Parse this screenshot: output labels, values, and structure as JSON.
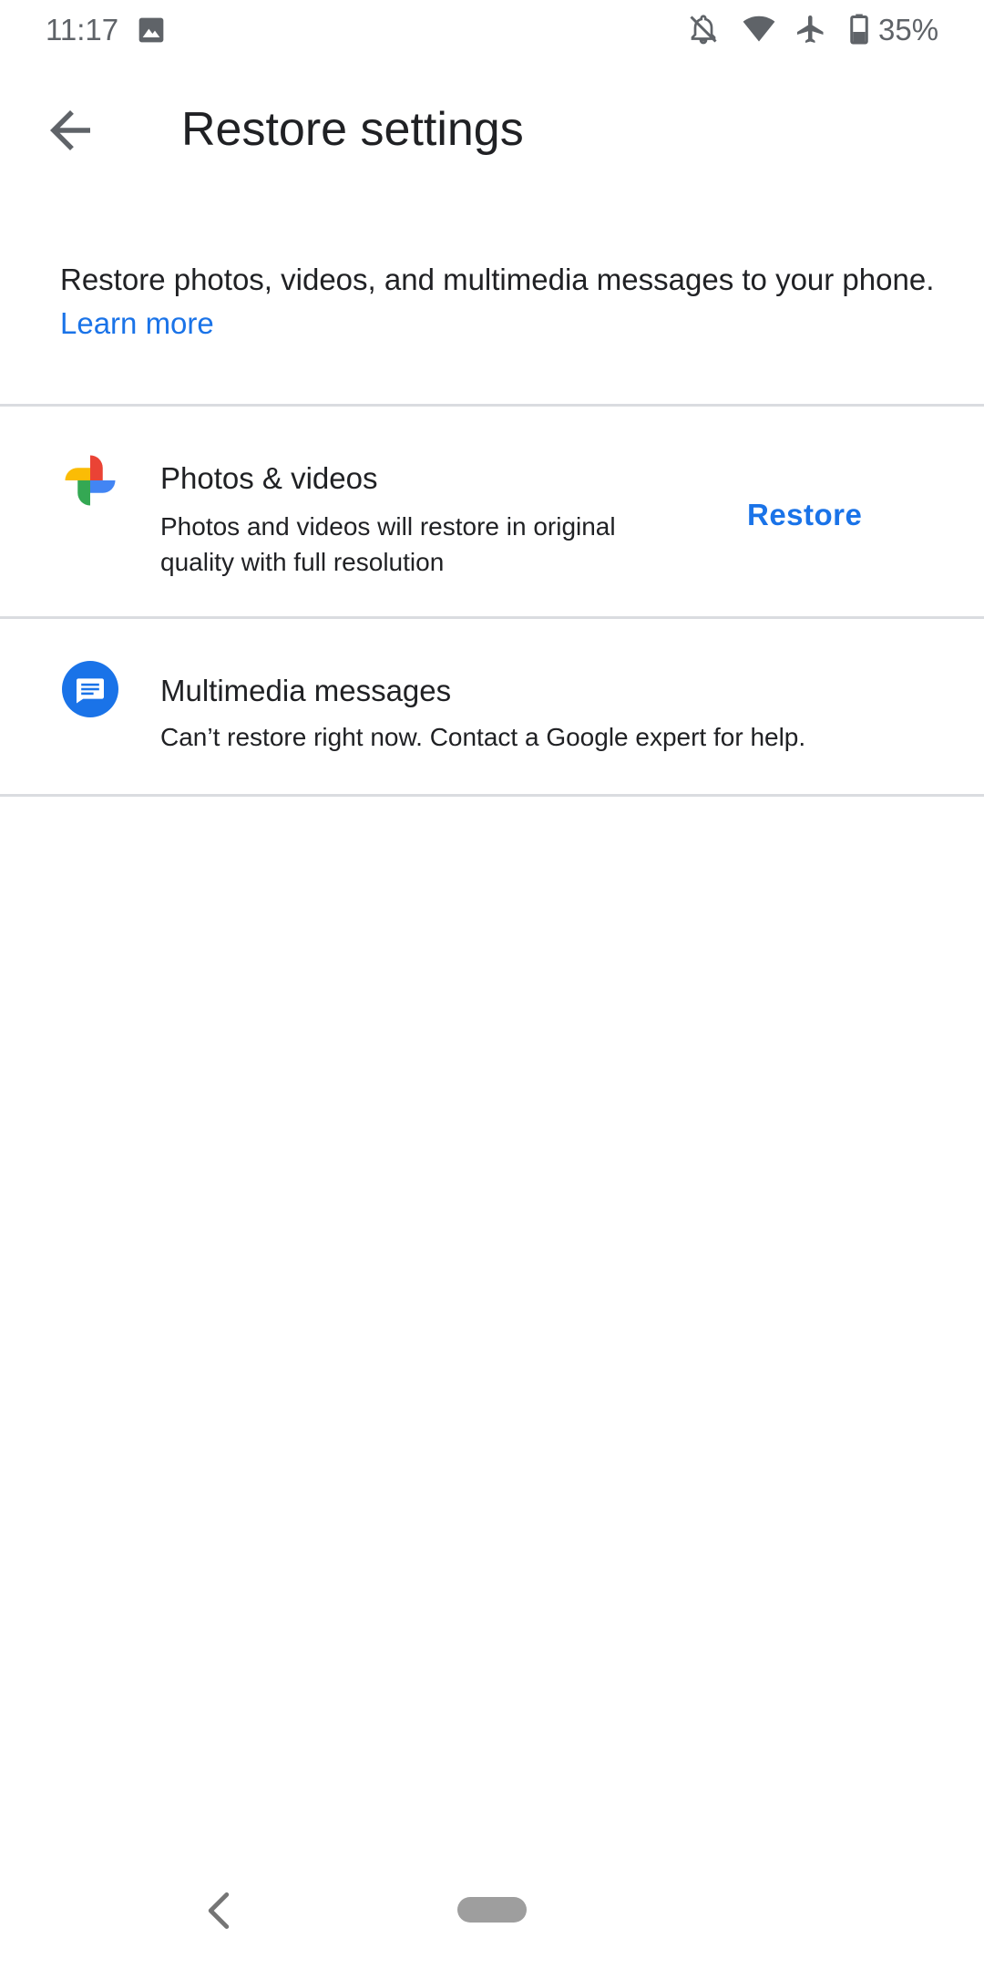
{
  "status_bar": {
    "time": "11:17",
    "battery": "35%",
    "icons": [
      "image-icon",
      "notifications-off-icon",
      "wifi-icon",
      "airplane-icon",
      "battery-icon"
    ]
  },
  "toolbar": {
    "title": "Restore settings",
    "back_icon": "arrow-back-icon"
  },
  "intro": {
    "text": "Restore photos, videos, and multimedia messages to your phone. ",
    "link": "Learn more"
  },
  "items": [
    {
      "icon": "google-photos-icon",
      "title": "Photos & videos",
      "subtitle_line1": "Photos and videos will restore in original",
      "subtitle_line2": "quality with full resolution",
      "action": "Restore"
    },
    {
      "icon": "messages-icon",
      "title": "Multimedia messages",
      "subtitle_line1": "Can’t restore right now. Contact a Google expert for help."
    }
  ],
  "colors": {
    "accent": "#1a73e8",
    "text": "#202124",
    "divider": "#dadce0",
    "messages_blue": "#1a73e8"
  },
  "nav_bar": {
    "back_icon": "nav-back-icon",
    "home_icon": "nav-home-pill"
  }
}
